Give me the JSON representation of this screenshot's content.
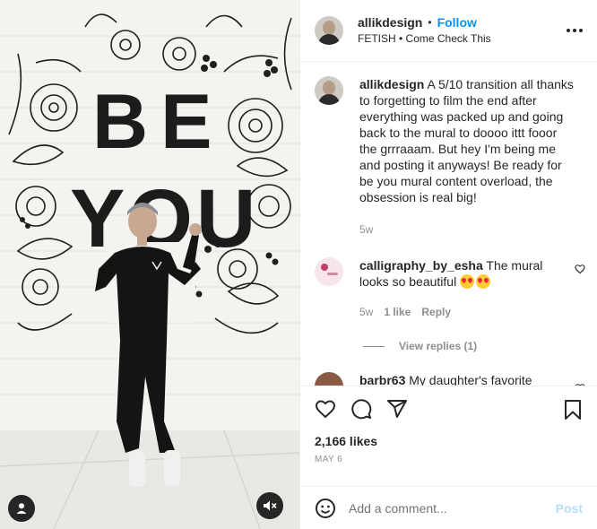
{
  "header": {
    "username": "allikdesign",
    "separator": "•",
    "follow_label": "Follow",
    "subtitle": "FETISH • Come Check This"
  },
  "caption": {
    "username": "allikdesign",
    "text": "A 5/10 transition all thanks to forgetting to film the end after everything was packed up and going back to the mural to doooo ittt fooor the grrraaam. But hey I'm being me and posting it anyways! Be ready for be you mural content overload, the obsession is real big!",
    "time": "5w"
  },
  "comments": [
    {
      "username": "calligraphy_by_esha",
      "text": "The mural looks so beautiful",
      "emojis": [
        "heart-eyes-emoji",
        "heart-eyes-emoji"
      ],
      "time": "5w",
      "likes": "1 like",
      "reply_label": "Reply",
      "view_replies": "View replies (1)"
    },
    {
      "username": "barbr63",
      "text": "My daughter's favorite"
    }
  ],
  "mural": {
    "line1": "BE",
    "line2": "YOU"
  },
  "likes_count": "2,166 likes",
  "date": "MAY 6",
  "add_comment": {
    "placeholder": "Add a comment...",
    "post_label": "Post"
  },
  "colors": {
    "accent": "#0095f6",
    "post_disabled": "#b2dffc",
    "muted": "#8e8e8e",
    "text": "#262626"
  },
  "icons": [
    "heart-icon",
    "comment-icon",
    "share-icon",
    "bookmark-icon",
    "emoji-icon",
    "more-icon",
    "user-icon",
    "mute-icon"
  ]
}
